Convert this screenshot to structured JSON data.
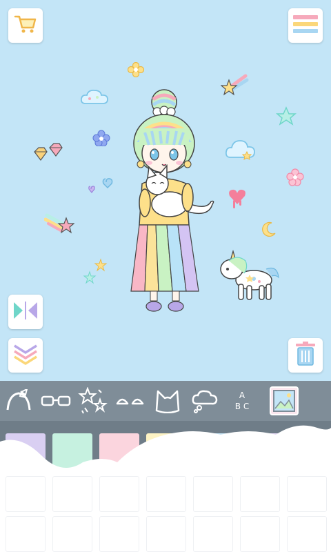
{
  "icons": {
    "shop": "shopping-cart-icon",
    "menu": "menu-icon",
    "flip": "flip-icon",
    "layer": "layer-down-icon",
    "trash": "trash-icon"
  },
  "toolbar": {
    "categories": [
      "hair-accessory",
      "glasses",
      "sparkle-effects",
      "eyebrows",
      "cat-ears",
      "thought-bubble",
      "text-abc",
      "background-image"
    ],
    "abc_top": "A",
    "abc_bottom": "B C"
  },
  "palette": {
    "colors": [
      "#d9cff2",
      "#c6f1e0",
      "#fbd5de",
      "#fdf3c4",
      "#c9e6f7",
      "#e8dbf6",
      "#ffffff"
    ]
  },
  "colors": {
    "background": "#c3e5f7",
    "toolbar": "#7f8d98",
    "rainbow": [
      "#f9b7c6",
      "#fbe39a",
      "#c9f2c3",
      "#b9e3f8",
      "#d4c4f3"
    ]
  }
}
